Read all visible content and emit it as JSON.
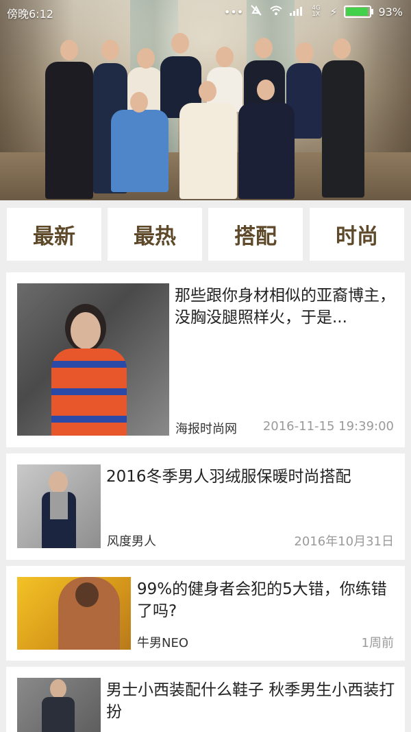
{
  "status_bar": {
    "time": "傍晚6:12",
    "battery": "93%",
    "network_label": "4G 1X",
    "battery_level": 0.93,
    "icons": [
      "more-dots-icon",
      "mute-icon",
      "wifi-icon",
      "signal-icon",
      "charging-icon",
      "battery-icon"
    ]
  },
  "hero": {
    "alt": "royal family group photo"
  },
  "tabs": [
    {
      "label": "最新"
    },
    {
      "label": "最热"
    },
    {
      "label": "搭配"
    },
    {
      "label": "时尚"
    }
  ],
  "colors": {
    "tab_text": "#5e4a2a",
    "background": "#eeeeee",
    "meta_gray": "#9a9a9a"
  },
  "articles": [
    {
      "title": "那些跟你身材相似的亚裔博主，没胸没腿照样火，于是...",
      "source": "海报时尚网",
      "time": "2016-11-15 19:39:00"
    },
    {
      "title": "2016冬季男人羽绒服保暖时尚搭配",
      "source": "风度男人",
      "time": "2016年10月31日"
    },
    {
      "title": "99%的健身者会犯的5大错，你练错了吗?",
      "source": "牛男NEO",
      "time": "1周前"
    },
    {
      "title": "男士小西装配什么鞋子 秋季男生小西装打扮",
      "source": "",
      "time": ""
    }
  ]
}
